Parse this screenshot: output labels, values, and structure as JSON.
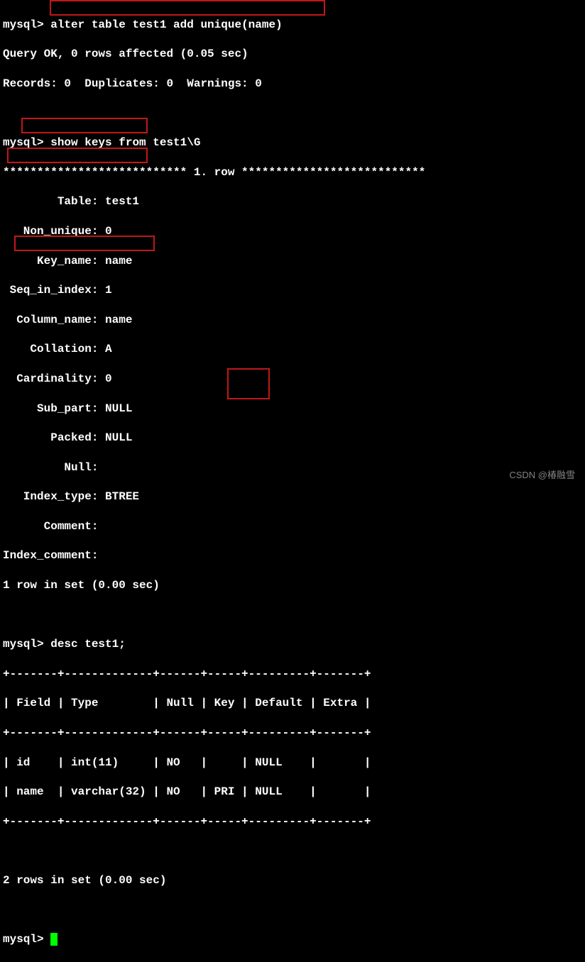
{
  "prompt": "mysql>",
  "commands": {
    "alter": "alter table test1 add unique(name)",
    "showkeys": "show keys from test1\\G",
    "desc": "desc test1;"
  },
  "alter_result": {
    "line1": "Query OK, 0 rows affected (0.05 sec)",
    "line2": "Records: 0  Duplicates: 0  Warnings: 0"
  },
  "row_header": "*************************** 1. row ***************************",
  "keys": {
    "table": "        Table: test1",
    "non_unique": "   Non_unique: 0",
    "key_name": "     Key_name: name",
    "seq_in_index": " Seq_in_index: 1",
    "column_name": "  Column_name: name",
    "collation": "    Collation: A",
    "cardinality": "  Cardinality: 0",
    "sub_part": "     Sub_part: NULL",
    "packed": "       Packed: NULL",
    "null": "         Null:",
    "index_type": "   Index_type: BTREE",
    "comment": "      Comment:",
    "index_comment": "Index_comment:"
  },
  "rows_result_1": "1 row in set (0.00 sec)",
  "desc_table": {
    "border": "+-------+-------------+------+-----+---------+-------+",
    "header": "| Field | Type        | Null | Key | Default | Extra |",
    "row1": "| id    | int(11)     | NO   |     | NULL    |       |",
    "row2": "| name  | varchar(32) | NO   | PRI | NULL    |       |"
  },
  "rows_result_2": "2 rows in set (0.00 sec)",
  "watermark": "CSDN @椿融雪"
}
